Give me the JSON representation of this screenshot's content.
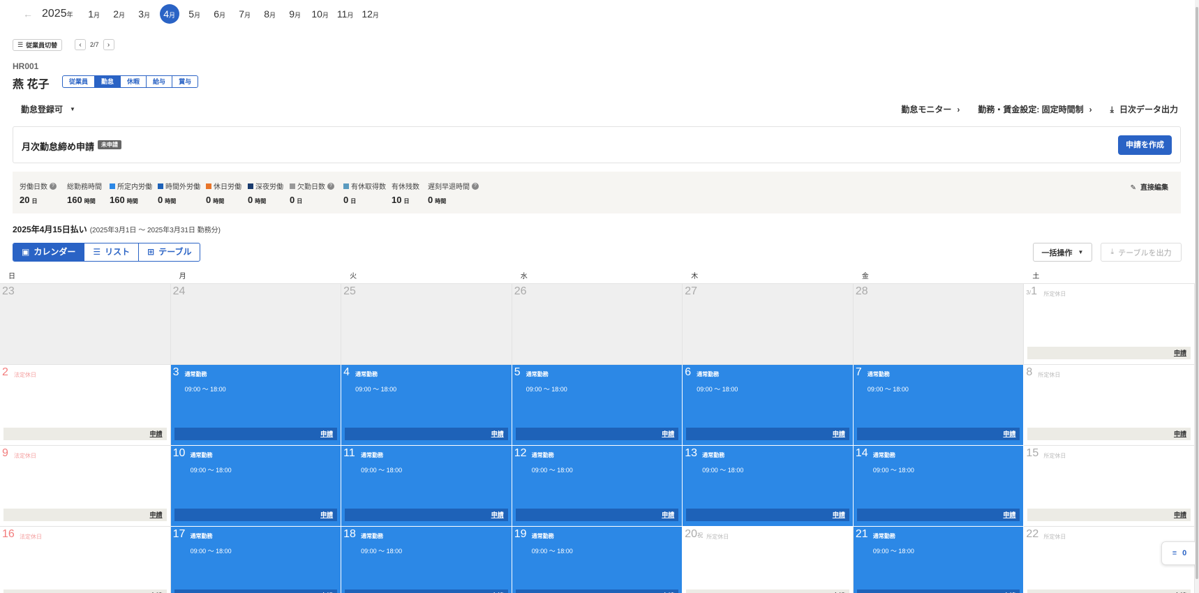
{
  "month_nav": {
    "back_label": "←",
    "year": "2025",
    "year_suffix": "年",
    "month_suffix": "月",
    "months": [
      "1",
      "2",
      "3",
      "4",
      "5",
      "6",
      "7",
      "8",
      "9",
      "10",
      "11",
      "12"
    ],
    "active_month": "4"
  },
  "employee": {
    "switch_label": "従業員切替",
    "pager": "2/7",
    "code": "HR001",
    "name": "燕 花子",
    "tabs": [
      "従業員",
      "勤怠",
      "休暇",
      "給与",
      "賞与"
    ],
    "active_tab": "勤怠"
  },
  "toolbar": {
    "status": "勤怠登録可",
    "monitor": "勤怠モニター",
    "settings": "勤務・賃金設定: 固定時間制",
    "daily_export": "日次データ出力"
  },
  "closing": {
    "label": "月次勤怠締め申請",
    "badge": "未申請",
    "create_button": "申請を作成"
  },
  "summary": {
    "stats": [
      {
        "label": "労働日数",
        "value": "20",
        "unit": "日",
        "help": true,
        "color": ""
      },
      {
        "label": "総勤務時間",
        "value": "160",
        "unit": "時間",
        "help": false,
        "color": ""
      },
      {
        "label": "所定内労働",
        "value": "160",
        "unit": "時間",
        "help": false,
        "color": "#2c88e6"
      },
      {
        "label": "時間外労働",
        "value": "0",
        "unit": "時間",
        "help": false,
        "color": "#1e62b8"
      },
      {
        "label": "休日労働",
        "value": "0",
        "unit": "時間",
        "help": false,
        "color": "#e8752a"
      },
      {
        "label": "深夜労働",
        "value": "0",
        "unit": "時間",
        "help": false,
        "color": "#1a3b6e"
      },
      {
        "label": "欠勤日数",
        "value": "0",
        "unit": "日",
        "help": true,
        "color": "#999999"
      },
      {
        "label": "有休取得数",
        "value": "0",
        "unit": "日",
        "help": false,
        "color": "#5b9bbf"
      },
      {
        "label": "有休残数",
        "value": "10",
        "unit": "日",
        "help": false,
        "color": ""
      },
      {
        "label": "遅刻早退時間",
        "value": "0",
        "unit": "時間",
        "help": true,
        "color": ""
      }
    ],
    "edit_label": "直接編集"
  },
  "payday": {
    "title": "2025年4月15日払い",
    "period": "(2025年3月1日 ～ 2025年3月31日 勤務分)"
  },
  "views": {
    "calendar": "カレンダー",
    "list": "リスト",
    "table": "テーブル",
    "bulk": "一括操作",
    "export": "テーブルを出力"
  },
  "calendar": {
    "weekdays": [
      "日",
      "月",
      "火",
      "水",
      "木",
      "金",
      "土"
    ],
    "work_label": "通常勤務",
    "work_time": "09:00 ～ 18:00",
    "apply_label": "申請",
    "days": [
      {
        "d": "23",
        "kind": "prev"
      },
      {
        "d": "24",
        "kind": "prev"
      },
      {
        "d": "25",
        "kind": "prev"
      },
      {
        "d": "26",
        "kind": "prev"
      },
      {
        "d": "27",
        "kind": "prev"
      },
      {
        "d": "28",
        "kind": "prev"
      },
      {
        "d": "1",
        "prefix": "3/",
        "kind": "sat",
        "tag": "所定休日"
      },
      {
        "d": "2",
        "kind": "sun",
        "tag": "法定休日"
      },
      {
        "d": "3",
        "kind": "work"
      },
      {
        "d": "4",
        "kind": "work"
      },
      {
        "d": "5",
        "kind": "work"
      },
      {
        "d": "6",
        "kind": "work"
      },
      {
        "d": "7",
        "kind": "work"
      },
      {
        "d": "8",
        "kind": "sat",
        "tag": "所定休日"
      },
      {
        "d": "9",
        "kind": "sun",
        "tag": "法定休日"
      },
      {
        "d": "10",
        "kind": "work"
      },
      {
        "d": "11",
        "kind": "work"
      },
      {
        "d": "12",
        "kind": "work"
      },
      {
        "d": "13",
        "kind": "work"
      },
      {
        "d": "14",
        "kind": "work"
      },
      {
        "d": "15",
        "kind": "sat",
        "tag": "所定休日"
      },
      {
        "d": "16",
        "kind": "sun",
        "tag": "法定休日"
      },
      {
        "d": "17",
        "kind": "work"
      },
      {
        "d": "18",
        "kind": "work"
      },
      {
        "d": "19",
        "kind": "work"
      },
      {
        "d": "20",
        "suffix": "祝",
        "kind": "hol",
        "tag": "所定休日"
      },
      {
        "d": "21",
        "kind": "work"
      },
      {
        "d": "22",
        "kind": "sat",
        "tag": "所定休日"
      }
    ]
  },
  "fab": {
    "count": "0"
  }
}
